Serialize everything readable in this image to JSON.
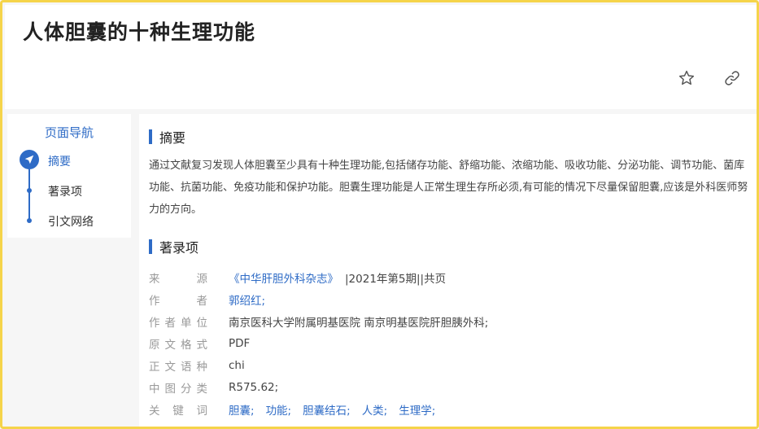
{
  "header": {
    "title": "人体胆囊的十种生理功能"
  },
  "icons": {
    "favorite": "star-icon",
    "share": "link-icon",
    "nav_active": "navigation-arrow-icon"
  },
  "colors": {
    "accent": "#2e6bc6",
    "frame": "#f5d44a",
    "key_text": "#999999",
    "body_text": "#444444"
  },
  "nav": {
    "title": "页面导航",
    "items": [
      {
        "label": "摘要",
        "active": true
      },
      {
        "label": "著录项",
        "active": false
      },
      {
        "label": "引文网络",
        "active": false
      }
    ]
  },
  "abstract": {
    "heading": "摘要",
    "text": "通过文献复习发现人体胆囊至少具有十种生理功能,包括储存功能、舒缩功能、浓缩功能、吸收功能、分泌功能、调节功能、菌库功能、抗菌功能、免疫功能和保护功能。胆囊生理功能是人正常生理生存所必须,有可能的情况下尽量保留胆囊,应该是外科医师努力的方向。"
  },
  "record": {
    "heading": "著录项",
    "source": {
      "key": "来源",
      "journal": "《中华肝胆外科杂志》",
      "detail": "|2021年第5期||共页"
    },
    "author": {
      "key": "作者",
      "value": "郭绍红;"
    },
    "affiliation": {
      "key": "作者单位",
      "value": "南京医科大学附属明基医院 南京明基医院肝胆胰外科;"
    },
    "format": {
      "key": "原文格式",
      "value": "PDF"
    },
    "language": {
      "key": "正文语种",
      "value": "chi"
    },
    "classification": {
      "key": "中图分类",
      "value": "R575.62;"
    },
    "keywords": {
      "key": "关键词",
      "items": [
        "胆囊;",
        "功能;",
        "胆囊结石;",
        "人类;",
        "生理学;"
      ]
    }
  }
}
